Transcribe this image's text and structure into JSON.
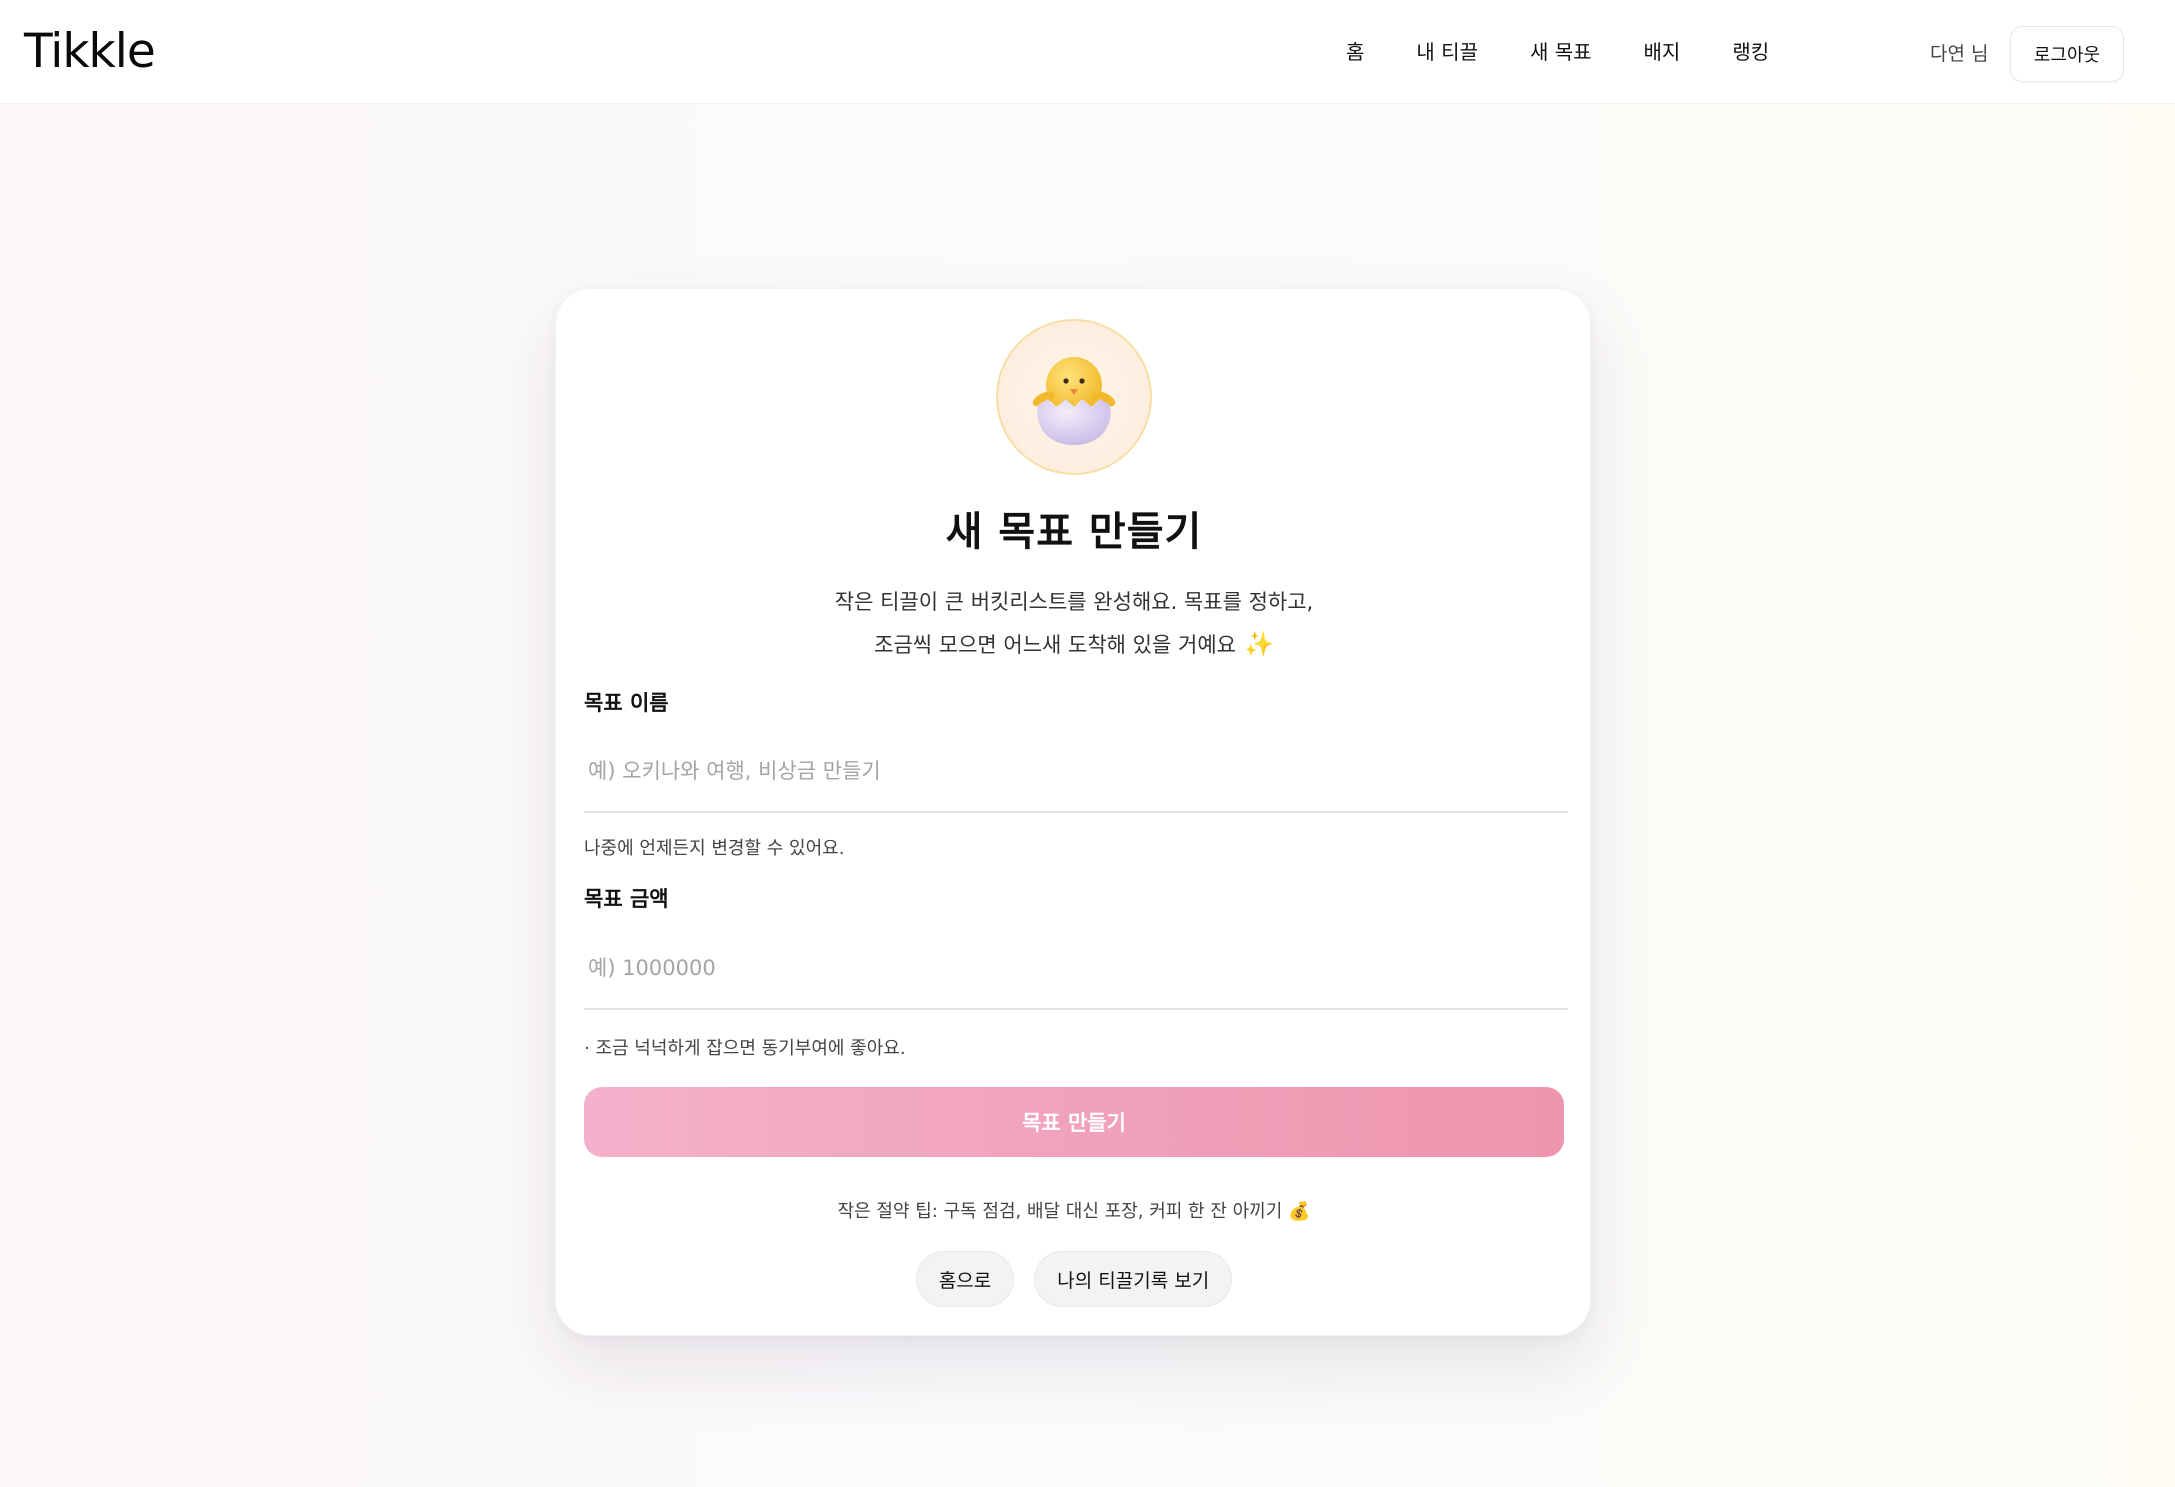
{
  "header": {
    "logo": "Tikkle",
    "nav": [
      "홈",
      "내 티끌",
      "새 목표",
      "배지",
      "랭킹"
    ],
    "user_name": "다연 님",
    "logout_label": "로그아웃"
  },
  "card": {
    "avatar_icon": "hatching-chick-icon",
    "title": "새 목표 만들기",
    "subtitle_line1": "작은 티끌이 큰 버킷리스트를 완성해요. 목표를 정하고,",
    "subtitle_line2": "조금씩 모으면 어느새 도착해 있을 거예요",
    "subtitle_emoji": "✨",
    "goal_name": {
      "label": "목표 이름",
      "value": "",
      "placeholder": "예) 오키나와 여행, 비상금 만들기",
      "hint": "나중에 언제든지 변경할 수 있어요."
    },
    "goal_amount": {
      "label": "목표 금액",
      "value": "",
      "placeholder": "예) 1000000",
      "hint": "·  조금 넉넉하게 잡으면 동기부여에 좋아요."
    },
    "submit_label": "목표 만들기",
    "tip": "작은 절약 팁: 구독 점검, 배달 대신 포장, 커피 한 잔 아끼기",
    "tip_emoji": "💰",
    "home_button": "홈으로",
    "records_button": "나의 티끌기록 보기"
  },
  "colors": {
    "accent_pink": "#f1a2bb",
    "avatar_border": "#f5dfa5"
  }
}
